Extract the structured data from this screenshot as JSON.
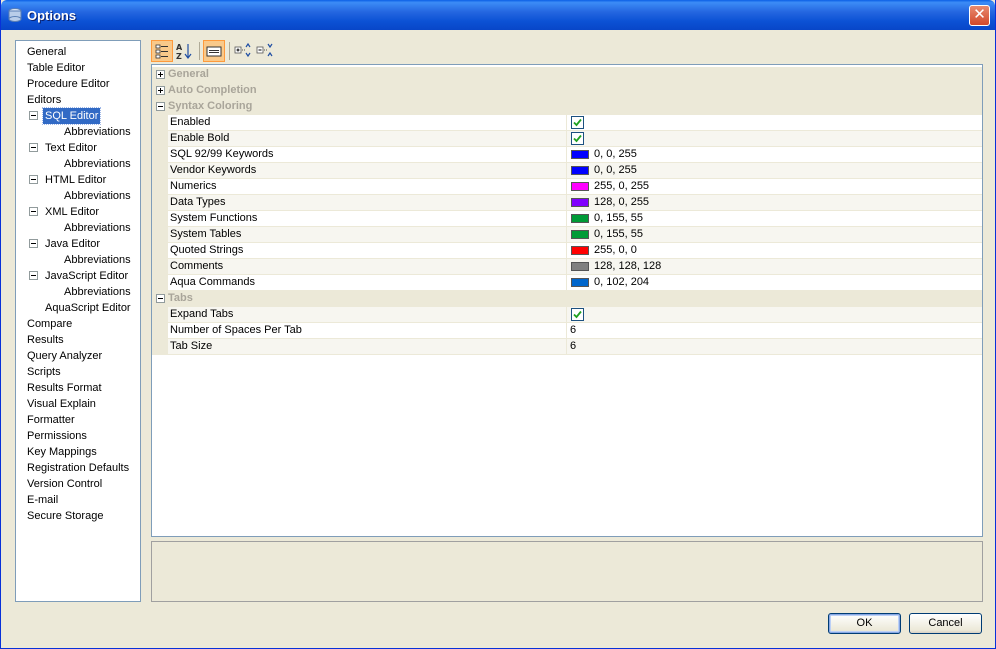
{
  "window": {
    "title": "Options",
    "close_glyph": "✕"
  },
  "tree": {
    "items": [
      {
        "label": "General",
        "indent": 0
      },
      {
        "label": "Table Editor",
        "indent": 0
      },
      {
        "label": "Procedure Editor",
        "indent": 0
      },
      {
        "label": "Editors",
        "indent": 0
      },
      {
        "label": "SQL Editor",
        "indent": 1,
        "expander": true,
        "selected": true
      },
      {
        "label": "Abbreviations",
        "indent": 2
      },
      {
        "label": "Text Editor",
        "indent": 1,
        "expander": true
      },
      {
        "label": "Abbreviations",
        "indent": 2
      },
      {
        "label": "HTML Editor",
        "indent": 1,
        "expander": true
      },
      {
        "label": "Abbreviations",
        "indent": 2
      },
      {
        "label": "XML Editor",
        "indent": 1,
        "expander": true
      },
      {
        "label": "Abbreviations",
        "indent": 2
      },
      {
        "label": "Java Editor",
        "indent": 1,
        "expander": true
      },
      {
        "label": "Abbreviations",
        "indent": 2
      },
      {
        "label": "JavaScript Editor",
        "indent": 1,
        "expander": true
      },
      {
        "label": "Abbreviations",
        "indent": 2
      },
      {
        "label": "AquaScript Editor",
        "indent": 1
      },
      {
        "label": "Compare",
        "indent": 0
      },
      {
        "label": "Results",
        "indent": 0
      },
      {
        "label": "Query Analyzer",
        "indent": 0
      },
      {
        "label": "Scripts",
        "indent": 0
      },
      {
        "label": "Results Format",
        "indent": 0
      },
      {
        "label": "Visual Explain",
        "indent": 0
      },
      {
        "label": "Formatter",
        "indent": 0
      },
      {
        "label": "Permissions",
        "indent": 0
      },
      {
        "label": "Key Mappings",
        "indent": 0
      },
      {
        "label": "Registration Defaults",
        "indent": 0
      },
      {
        "label": "Version Control",
        "indent": 0
      },
      {
        "label": "E-mail",
        "indent": 0
      },
      {
        "label": "Secure Storage",
        "indent": 0
      }
    ]
  },
  "toolbar": {
    "buttons": [
      {
        "icon": "categorized-icon",
        "active": true
      },
      {
        "icon": "sort-alphabetical-icon",
        "active": false
      },
      {
        "icon": "property-pages-icon",
        "active": true
      },
      {
        "icon": "expand-all-icon",
        "active": false
      },
      {
        "icon": "collapse-all-icon",
        "active": false
      }
    ]
  },
  "grid": {
    "sections": [
      {
        "label": "General",
        "expanded": false,
        "rows": []
      },
      {
        "label": "Auto Completion",
        "expanded": false,
        "rows": []
      },
      {
        "label": "Syntax Coloring",
        "expanded": true,
        "rows": [
          {
            "name": "Enabled",
            "type": "check",
            "checked": true
          },
          {
            "name": "Enable Bold",
            "type": "check",
            "checked": true
          },
          {
            "name": "SQL 92/99 Keywords",
            "type": "color",
            "color": "#0000ff",
            "value": "0, 0, 255"
          },
          {
            "name": "Vendor Keywords",
            "type": "color",
            "color": "#0000ff",
            "value": "0, 0, 255"
          },
          {
            "name": "Numerics",
            "type": "color",
            "color": "#ff00ff",
            "value": "255, 0, 255"
          },
          {
            "name": "Data Types",
            "type": "color",
            "color": "#8000ff",
            "value": "128, 0, 255"
          },
          {
            "name": "System Functions",
            "type": "color",
            "color": "#009b37",
            "value": "0, 155, 55"
          },
          {
            "name": "System Tables",
            "type": "color",
            "color": "#009b37",
            "value": "0, 155, 55"
          },
          {
            "name": "Quoted Strings",
            "type": "color",
            "color": "#ff0000",
            "value": "255, 0, 0"
          },
          {
            "name": "Comments",
            "type": "color",
            "color": "#808080",
            "value": "128, 128, 128"
          },
          {
            "name": "Aqua Commands",
            "type": "color",
            "color": "#0066cc",
            "value": "0, 102, 204"
          }
        ]
      },
      {
        "label": "Tabs",
        "expanded": true,
        "rows": [
          {
            "name": "Expand Tabs",
            "type": "check",
            "checked": true
          },
          {
            "name": "Number of Spaces Per Tab",
            "type": "text",
            "value": "6"
          },
          {
            "name": "Tab Size",
            "type": "text",
            "value": "6"
          }
        ]
      }
    ]
  },
  "buttons": {
    "ok": "OK",
    "cancel": "Cancel"
  }
}
